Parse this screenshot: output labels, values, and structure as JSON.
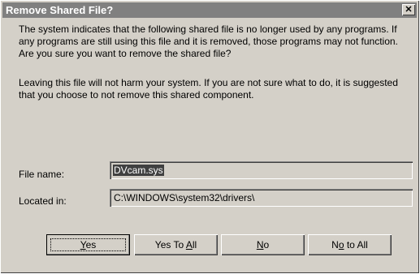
{
  "dialog": {
    "title": "Remove Shared File?",
    "close_glyph": "✕",
    "message_1": "The system indicates that the following shared file is no longer used by any programs.  If any programs are still using this file and it is removed, those programs may not function.  Are you sure you want to remove the shared file?",
    "message_2": "Leaving this file will not harm your system.  If you are not sure what to do, it is suggested that you choose to not remove this shared component."
  },
  "fields": {
    "file_name_label": "File name:",
    "file_name_value": "DVcam.sys",
    "located_in_label": "Located in:",
    "located_in_value": "C:\\WINDOWS\\system32\\drivers\\"
  },
  "buttons": {
    "yes": {
      "pre": "",
      "key": "Y",
      "post": "es"
    },
    "yes_to_all": {
      "pre": "Yes To ",
      "key": "A",
      "post": "ll"
    },
    "no": {
      "pre": "",
      "key": "N",
      "post": "o"
    },
    "no_to_all": {
      "pre": "N",
      "key": "o",
      "post": " to All"
    }
  },
  "colors": {
    "dialog_face": "#d4d0c8",
    "titlebar_inactive": "#808080",
    "selection": "#404040"
  }
}
